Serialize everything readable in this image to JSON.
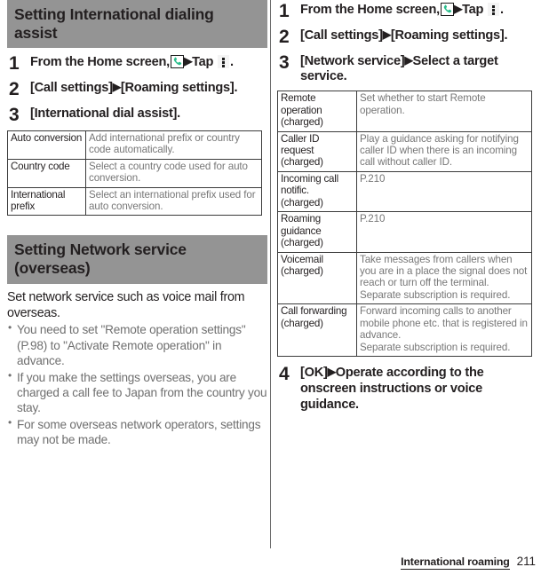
{
  "page": {
    "footer_section": "International roaming",
    "page_number": "211"
  },
  "icons": {
    "phone": "phone-handset-icon",
    "overflow": "overflow-menu-icon",
    "phone_color": "#2bbd8c"
  },
  "left_column": {
    "section1": {
      "banner": "Setting International dialing assist",
      "steps": [
        {
          "num": "1",
          "pre": "From the Home screen,",
          "mid": "Tap",
          "post": "."
        },
        {
          "num": "2",
          "text_a": "[Call settings]",
          "text_b": "[Roaming settings]."
        },
        {
          "num": "3",
          "text_a": "[International dial assist]."
        }
      ],
      "table": {
        "rows": [
          {
            "key": "Auto conversion",
            "value": "Add international prefix or country code automatically."
          },
          {
            "key": "Country code",
            "value": "Select a country code used for auto conversion."
          },
          {
            "key": "International prefix",
            "value": "Select an international prefix used for auto conversion."
          }
        ]
      }
    },
    "section2": {
      "banner": "Setting Network service (overseas)",
      "intro": "Set network service such as voice mail from overseas.",
      "notes": [
        "You need to set \"Remote operation settings\" (P.98) to \"Activate Remote operation\" in advance.",
        "If you make the settings overseas, you are charged a call fee to Japan from the country you stay.",
        "For some overseas network operators, settings may not be made."
      ]
    }
  },
  "right_column": {
    "steps": [
      {
        "num": "1",
        "pre": "From the Home screen,",
        "mid": "Tap",
        "post": "."
      },
      {
        "num": "2",
        "text_a": "[Call settings]",
        "text_b": "[Roaming settings]."
      },
      {
        "num": "3",
        "text_a": "[Network service]",
        "text_b": "Select a target service."
      }
    ],
    "table": {
      "rows": [
        {
          "key": "Remote operation (charged)",
          "value": "Set whether to start Remote operation."
        },
        {
          "key": "Caller ID request (charged)",
          "value": "Play a guidance asking for notifying caller ID when there is an incoming call without caller ID."
        },
        {
          "key": "Incoming call notific. (charged)",
          "value": "P.210"
        },
        {
          "key": "Roaming guidance (charged)",
          "value": "P.210"
        },
        {
          "key": "Voicemail (charged)",
          "value": "Take messages from callers when you are in a place the signal does not reach or turn off the terminal.\nSeparate subscription is required."
        },
        {
          "key": "Call forwarding (charged)",
          "value": "Forward incoming calls to another mobile phone etc. that is registered in advance.\nSeparate subscription is required."
        }
      ]
    },
    "final_step": {
      "num": "4",
      "text_a": "[OK]",
      "text_b": "Operate according to the onscreen instructions or voice guidance."
    }
  }
}
